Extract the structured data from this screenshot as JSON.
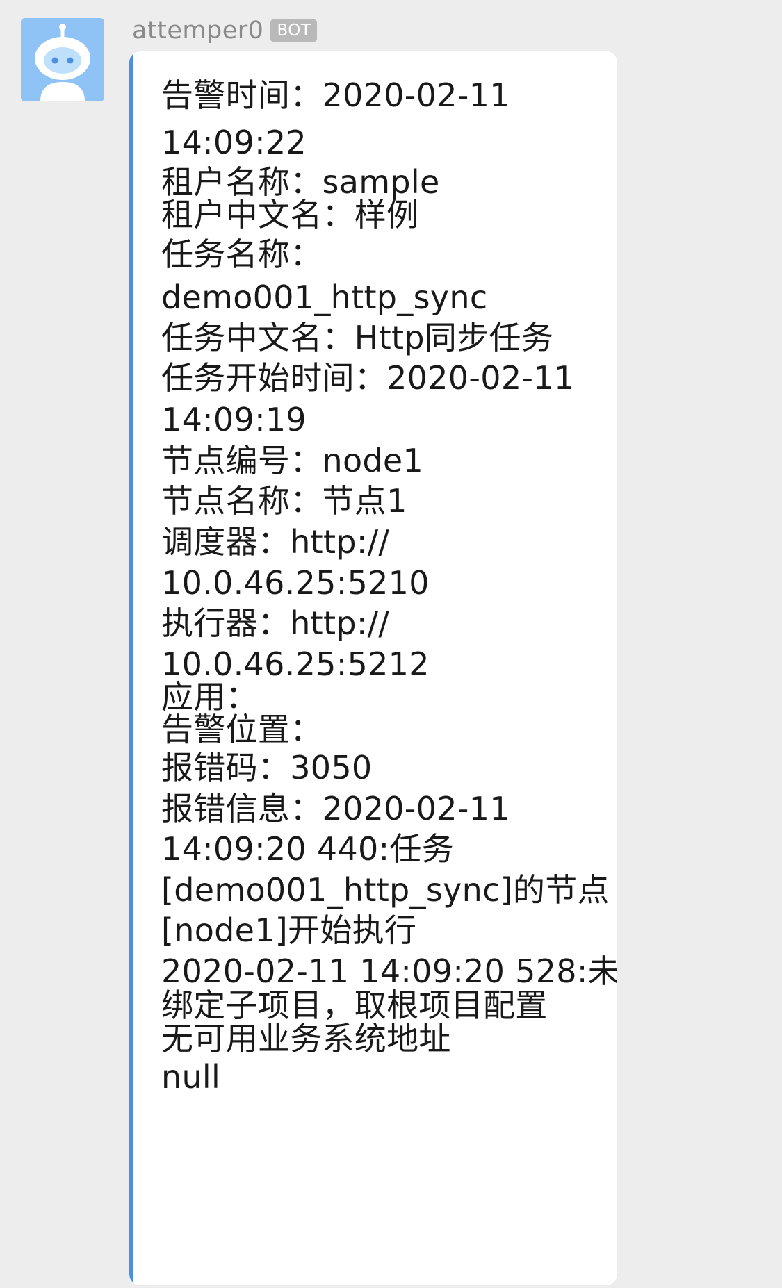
{
  "sender": {
    "name": "attemper0",
    "badge": "BOT"
  },
  "message": {
    "lines": [
      "告警时间：2020-02-11",
      "14:09:22",
      "租户名称：sample",
      "租户中文名：样例",
      "任务名称：",
      "demo001_http_sync",
      "任务中文名：Http同步任务",
      "任务开始时间：2020-02-11",
      "14:09:19",
      "节点编号：node1",
      "节点名称：节点1",
      "调度器：http://",
      "10.0.46.25:5210",
      "执行器：http://",
      "10.0.46.25:5212",
      "应用：",
      "告警位置：",
      "报错码：3050",
      "报错信息：2020-02-11",
      "14:09:20 440:任务",
      "[demo001_http_sync]的节点",
      "[node1]开始执行",
      "2020-02-11 14:09:20 528:未",
      "绑定子项目，取根项目配置",
      "无可用业务系统地址",
      "null"
    ]
  },
  "colors": {
    "background": "#ededed",
    "bubble": "#ffffff",
    "accent": "#4a8fe3",
    "text": "#191919",
    "sender": "#8a8a8a",
    "badge": "#b9b9b9",
    "avatar_bg": "#8fc3f5"
  },
  "icons": {
    "avatar": "robot-avatar-icon"
  }
}
